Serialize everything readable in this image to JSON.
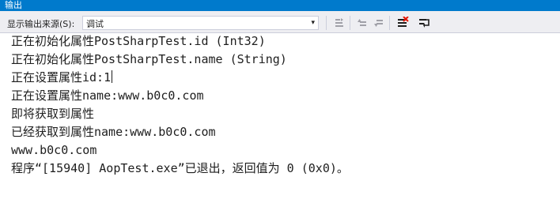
{
  "window": {
    "title": "输出"
  },
  "toolbar": {
    "source_label": "显示输出来源(S):",
    "source_value": "调试",
    "icons": [
      "go-to-location-icon",
      "prev-message-icon",
      "next-message-icon",
      "clear-all-icon",
      "word-wrap-icon"
    ]
  },
  "output": {
    "lines": [
      "正在初始化属性PostSharpTest.id (Int32)",
      "正在初始化属性PostSharpTest.name (String)",
      "正在设置属性id:1",
      "正在设置属性name:www.b0c0.com",
      "即将获取到属性",
      "已经获取到属性name:www.b0c0.com",
      "www.b0c0.com",
      "程序“[15940] AopTest.exe”已退出，返回值为 0 (0x0)。"
    ]
  },
  "colors": {
    "titlebar": "#007acc",
    "toolbar_bg": "#eeeef2",
    "text": "#1e1e1e"
  }
}
